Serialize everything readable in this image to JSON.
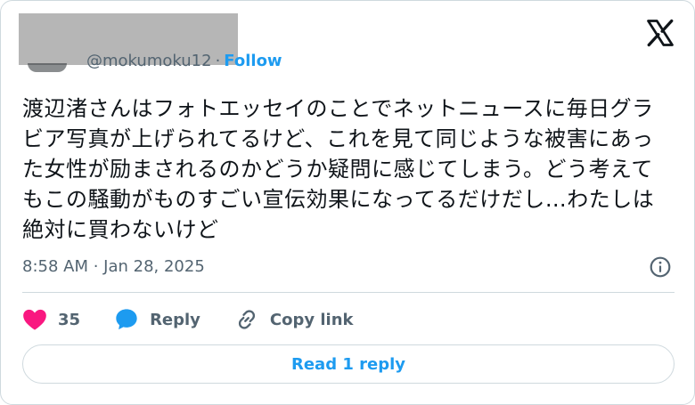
{
  "author": {
    "handle_partial": "@mokumoku12",
    "separator": "·",
    "follow_label": "Follow"
  },
  "tweet": {
    "text": "渡辺渚さんはフォトエッセイのことでネットニュースに毎日グラビア写真が上げられてるけど、これを見て同じような被害にあった女性が励まされるのかどうか疑問に感じてしまう。どう考えてもこの騒動がものすごい宣伝効果になってるだけだし…わたしは絶対に買わないけど",
    "timestamp": "8:58 AM · Jan 28, 2025"
  },
  "actions": {
    "like_count": "35",
    "reply_label": "Reply",
    "copy_link_label": "Copy link"
  },
  "read_replies_label": "Read 1 reply",
  "icons": [
    "x-logo-icon",
    "info-icon",
    "heart-icon",
    "reply-bubble-icon",
    "link-icon"
  ],
  "colors": {
    "accent": "#1d9bf0",
    "like": "#f91880",
    "secondary_text": "#536471",
    "border": "#cfd9de"
  }
}
